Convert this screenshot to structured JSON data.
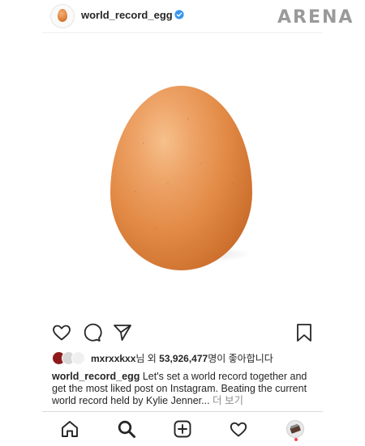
{
  "watermark": "ARENA",
  "post": {
    "username": "world_record_egg",
    "verified": true
  },
  "likes": {
    "first_liker": "mxrxxkxx",
    "suffix_1": "님 외 ",
    "count": "53,926,477",
    "suffix_2": "명이 좋아합니다"
  },
  "caption": {
    "username": "world_record_egg",
    "text": " Let's set a world record together and get the most liked post on Instagram. Beating the current world record held by Kylie Jenner...",
    "more": " 더 보기"
  },
  "icons": {
    "actions": [
      "heart-icon",
      "comment-icon",
      "share-icon",
      "bookmark-icon"
    ],
    "nav": [
      "home-icon",
      "search-icon",
      "new-post-icon",
      "activity-icon",
      "profile-icon"
    ]
  },
  "colors": {
    "text": "#262626",
    "muted": "#8e8e8e",
    "verified_blue": "#3897f0",
    "egg": "#e38c48",
    "notification": "#ed4956"
  }
}
